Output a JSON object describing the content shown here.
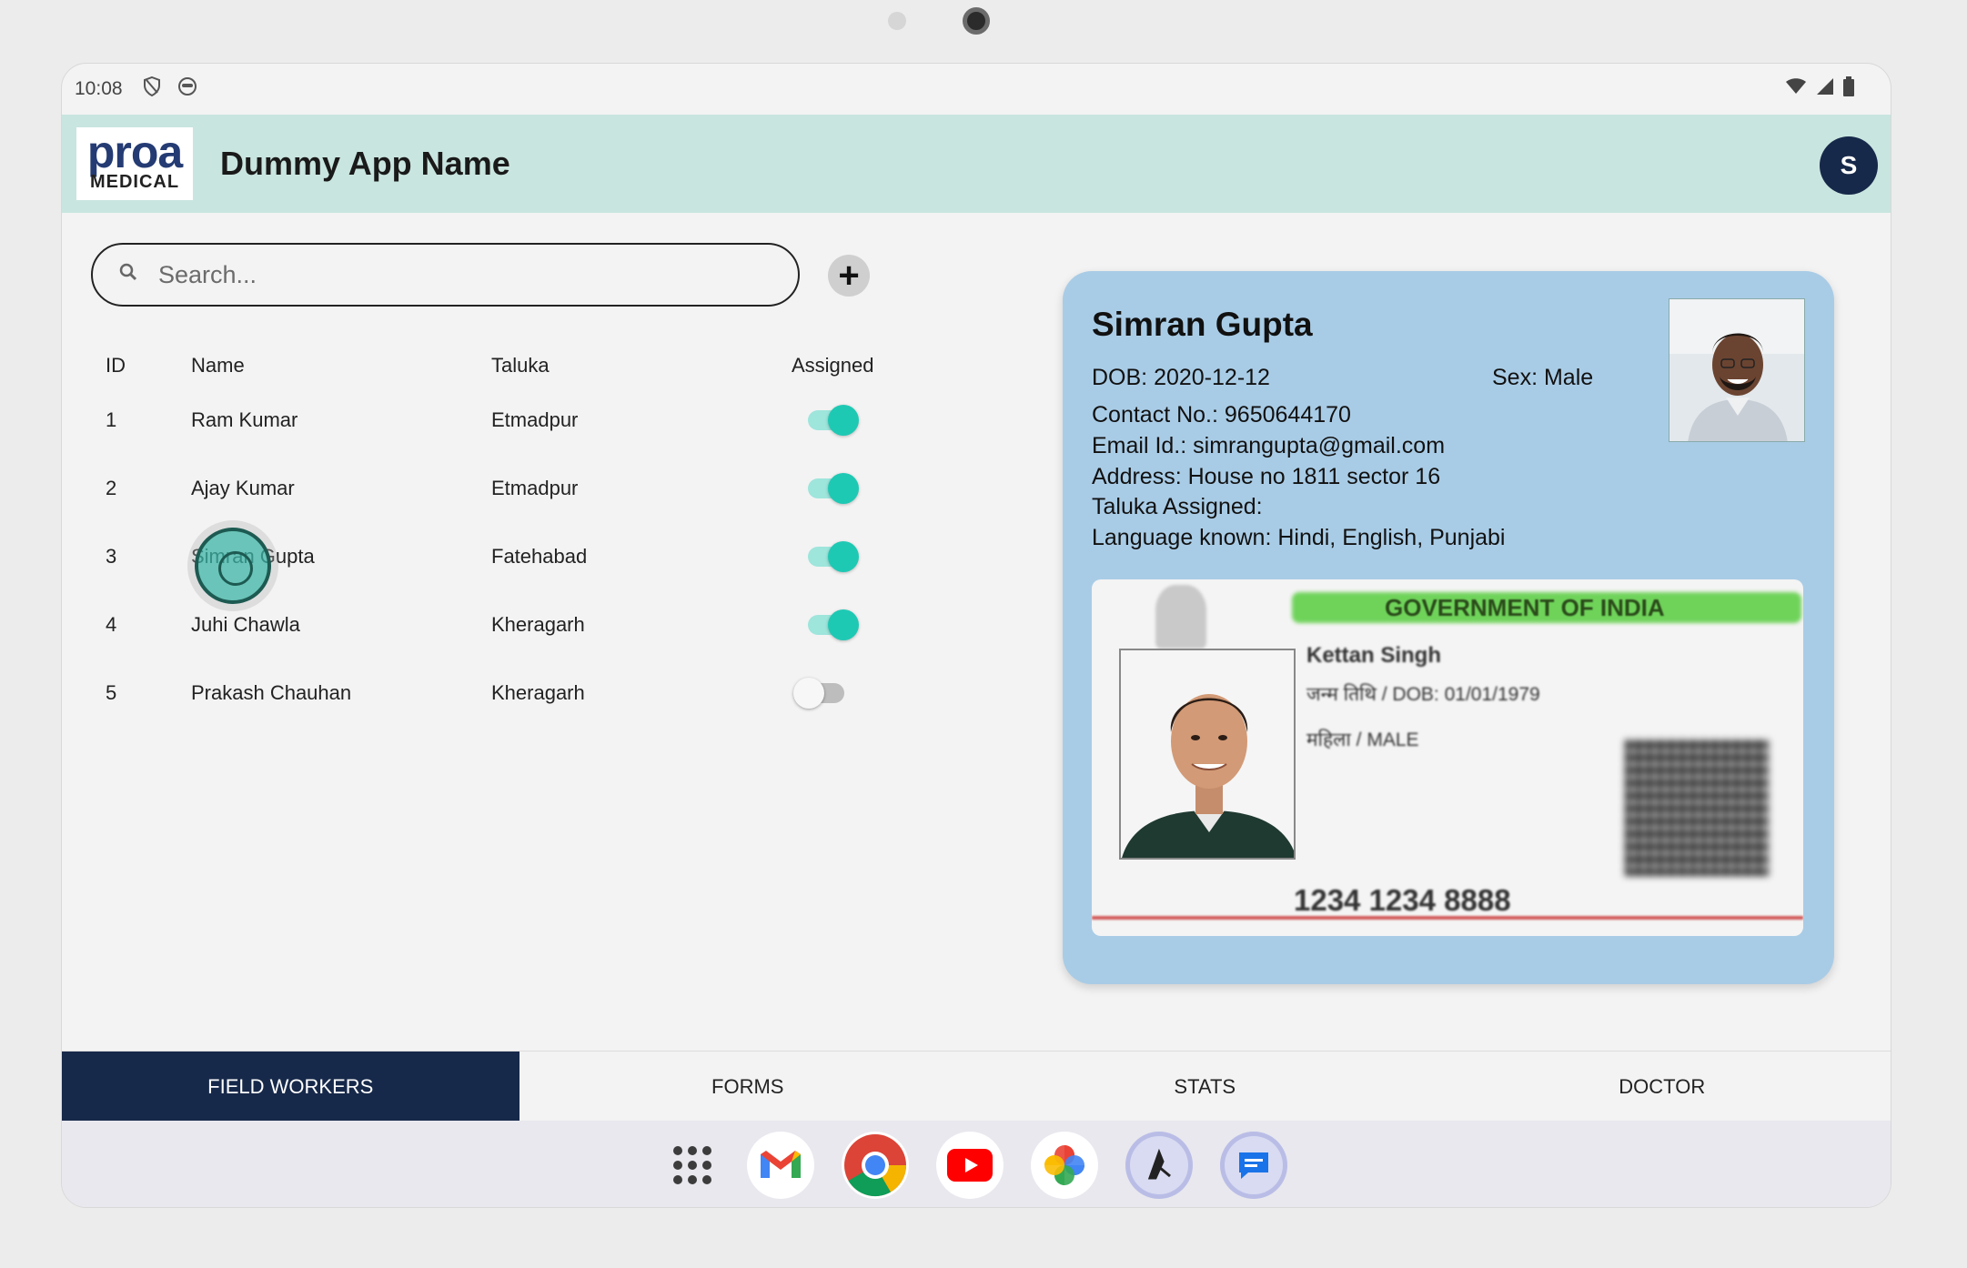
{
  "status_bar": {
    "time": "10:08"
  },
  "app_bar": {
    "logo_top": "proa",
    "logo_bottom": "MEDICAL",
    "title": "Dummy App Name",
    "avatar_initial": "S"
  },
  "search": {
    "placeholder": "Search...",
    "value": ""
  },
  "add_button": {
    "label": "+"
  },
  "table": {
    "headers": [
      "ID",
      "Name",
      "Taluka",
      "Assigned"
    ],
    "rows": [
      {
        "id": "1",
        "name": "Ram Kumar",
        "taluka": "Etmadpur",
        "assigned": true
      },
      {
        "id": "2",
        "name": "Ajay Kumar",
        "taluka": "Etmadpur",
        "assigned": true
      },
      {
        "id": "3",
        "name": "Simran Gupta",
        "taluka": "Fatehabad",
        "assigned": true
      },
      {
        "id": "4",
        "name": "Juhi Chawla",
        "taluka": "Kheragarh",
        "assigned": true
      },
      {
        "id": "5",
        "name": "Prakash Chauhan",
        "taluka": "Kheragarh",
        "assigned": false
      }
    ]
  },
  "detail": {
    "name": "Simran Gupta",
    "dob": "DOB: 2020-12-12",
    "sex": "Sex: Male",
    "contact": "Contact No.: 9650644170",
    "email": "Email Id.: simrangupta@gmail.com",
    "address": "Address: House no 1811 sector 16",
    "taluka": "Taluka Assigned:",
    "languages": "Language known: Hindi, English, Punjabi",
    "id_card": {
      "header": "GOVERNMENT OF INDIA",
      "holder_name": "Kettan Singh",
      "dob_line": "जन्म तिथि / DOB: 01/01/1979",
      "gender_line": "महिला / MALE",
      "number": "1234 1234 8888"
    }
  },
  "tabs": [
    {
      "label": "FIELD WORKERS",
      "active": true
    },
    {
      "label": "FORMS",
      "active": false
    },
    {
      "label": "STATS",
      "active": false
    },
    {
      "label": "DOCTOR",
      "active": false
    }
  ],
  "colors": {
    "app_bar_bg": "#c9e5df",
    "primary_dark": "#17294a",
    "toggle_on": "#1ec9b4",
    "card_bg": "#a9cce6"
  },
  "dock_icons": [
    "app-drawer-icon",
    "gmail-icon",
    "chrome-icon",
    "youtube-icon",
    "photos-icon",
    "app-icon",
    "messages-icon"
  ]
}
